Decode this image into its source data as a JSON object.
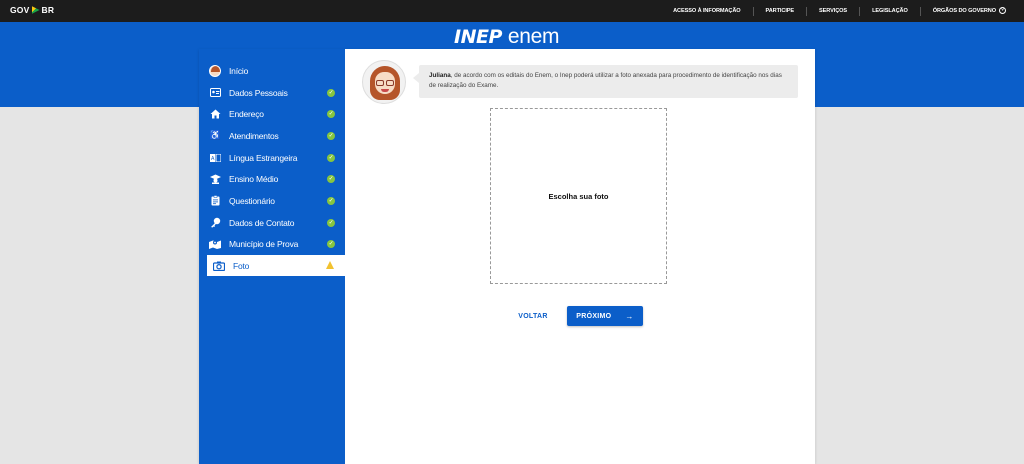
{
  "govbar": {
    "logo": "GOV BR",
    "links": [
      "ACESSO À INFORMAÇÃO",
      "PARTICIPE",
      "SERVIÇOS",
      "LEGISLAÇÃO",
      "ÓRGÃOS DO GOVERNO"
    ]
  },
  "brand": {
    "inep": "INEP",
    "enem": "enem"
  },
  "sidebar": {
    "items": [
      {
        "label": "Início",
        "icon": "avatar-icon",
        "status": "none"
      },
      {
        "label": "Dados Pessoais",
        "icon": "id-card-icon",
        "status": "complete"
      },
      {
        "label": "Endereço",
        "icon": "home-icon",
        "status": "complete"
      },
      {
        "label": "Atendimentos",
        "icon": "wheelchair-icon",
        "status": "complete"
      },
      {
        "label": "Língua Estrangeira",
        "icon": "language-icon",
        "status": "complete"
      },
      {
        "label": "Ensino Médio",
        "icon": "graduation-icon",
        "status": "complete"
      },
      {
        "label": "Questionário",
        "icon": "clipboard-icon",
        "status": "complete"
      },
      {
        "label": "Dados de Contato",
        "icon": "key-icon",
        "status": "complete"
      },
      {
        "label": "Município de Prova",
        "icon": "map-icon",
        "status": "complete"
      },
      {
        "label": "Foto",
        "icon": "camera-icon",
        "status": "warning"
      }
    ]
  },
  "assistant": {
    "name": "Juliana",
    "message": ", de acordo com os editais do Enem, o Inep poderá utilizar a foto anexada para procedimento de identificação nos dias de realização do Exame."
  },
  "photo": {
    "label": "Escolha sua foto"
  },
  "actions": {
    "back": "VOLTAR",
    "next": "PRÓXIMO",
    "next_icon": "→"
  },
  "colors": {
    "primary": "#0b5ec9",
    "success": "#86c540",
    "warning": "#f2c230",
    "govbar": "#1c1c1c"
  }
}
